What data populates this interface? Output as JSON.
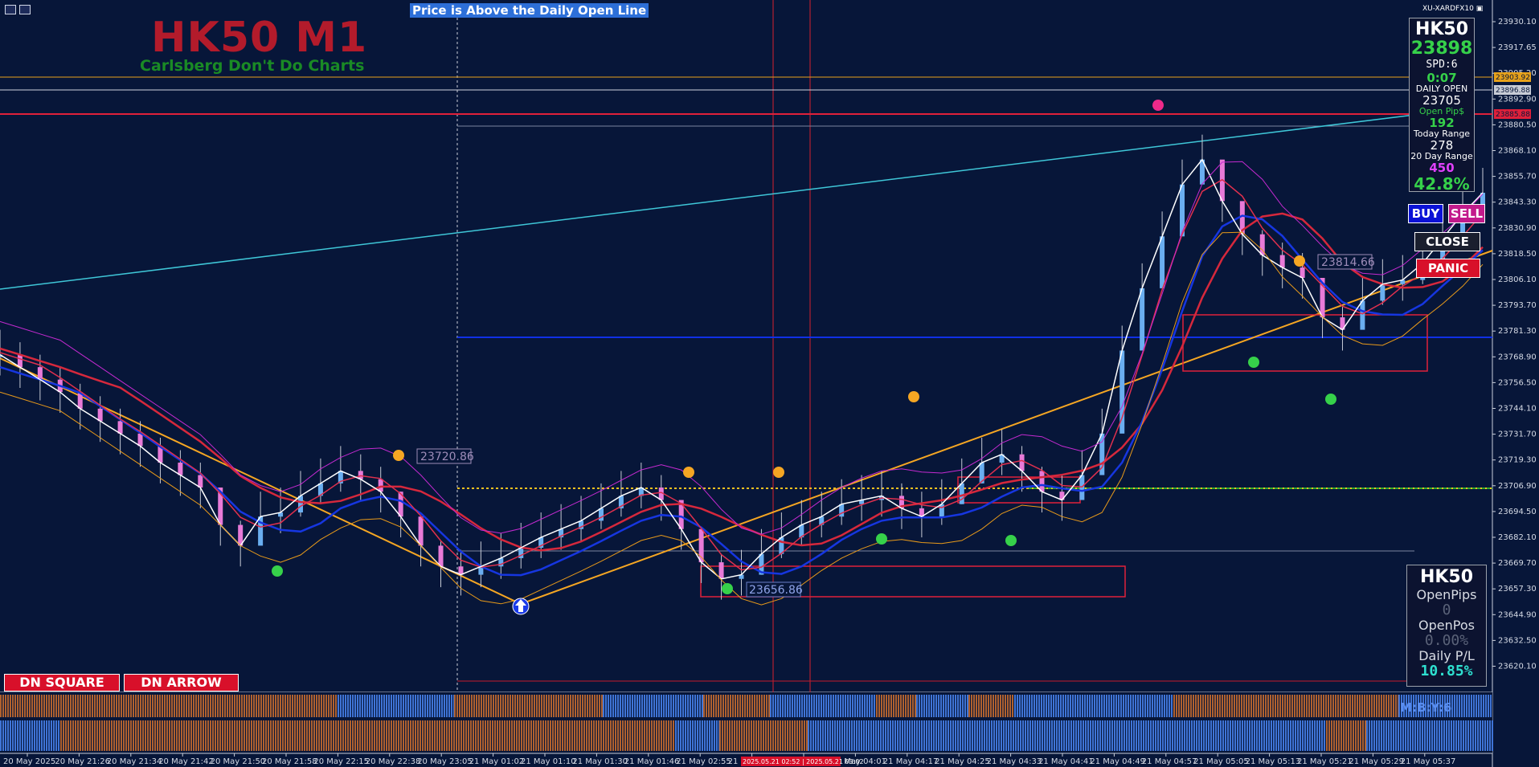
{
  "header": {
    "banner": "Price is Above the Daily Open Line",
    "title": "HK50 M1",
    "subtitle": "Carlsberg Don't Do Charts",
    "symbol_badge": "XU-XARDFX10"
  },
  "toolbar_icons": [
    "chart-list-icon",
    "chart-properties-icon"
  ],
  "info_panel": {
    "symbol": "HK50",
    "price": "23898",
    "spread": "SPD:6",
    "timer": "0:07",
    "daily_open_label": "DAILY OPEN",
    "daily_open": "23705",
    "open_pips_label": "Open Pip$",
    "open_pips": "192",
    "today_range_label": "Today Range",
    "today_range": "278",
    "day20_range_label": "20 Day Range",
    "day20_range": "450",
    "pct": "42.8%"
  },
  "trade_buttons": {
    "buy": "BUY",
    "sell": "SELL",
    "close": "CLOSE",
    "panic": "PANIC"
  },
  "pl_panel": {
    "symbol": "HK50",
    "open_pips_label": "OpenPips",
    "open_pips": "0",
    "open_pos_label": "OpenPos",
    "open_pos": "0.00%",
    "daily_pl_label": "Daily P/L",
    "daily_pl": "10.85%"
  },
  "bottom_buttons": {
    "dn_square": "DN SQUARE",
    "dn_arrow": "DN ARROW"
  },
  "indicator_label": "M:B:Y:6",
  "annotations": {
    "label_a": "23720.86",
    "label_b": "23656.86",
    "label_c": "23814.66"
  },
  "price_axis": {
    "ticks": [
      "23930.10",
      "23917.65",
      "23905.20",
      "23892.90",
      "23880.50",
      "23868.10",
      "23855.70",
      "23843.30",
      "23830.90",
      "23818.50",
      "23806.10",
      "23793.70",
      "23781.30",
      "23768.90",
      "23756.50",
      "23744.10",
      "23731.70",
      "23719.30",
      "23706.90",
      "23694.50",
      "23682.10",
      "23669.70",
      "23657.30",
      "23644.90",
      "23632.50",
      "23620.10"
    ],
    "tags": [
      {
        "text": "23903.92",
        "color": "#e8a21a"
      },
      {
        "text": "23896.88",
        "color": "#c8ccd6"
      },
      {
        "text": "23885.88",
        "color": "#e0203a"
      }
    ]
  },
  "time_axis": {
    "labels": [
      "20 May 2025",
      "20 May 21:26",
      "20 May 21:34",
      "20 May 21:42",
      "20 May 21:50",
      "20 May 21:58",
      "20 May 22:15",
      "20 May 22:38",
      "20 May 23:05",
      "21 May 01:02",
      "21 May 01:10",
      "21 May 01:30",
      "21 May 01:46",
      "21 May 02:55",
      "21 May",
      "21 May 03:32",
      "21 May 04:01",
      "21 May 04:17",
      "21 May 04:25",
      "21 May 04:33",
      "21 May 04:41",
      "21 May 04:49",
      "21 May 04:57",
      "21 May 05:05",
      "21 May 05:13",
      "21 May 05:21",
      "21 May 05:29",
      "21 May 05:37"
    ],
    "highlight": "2025.05.21 02:52 | 2025.05.21 03:02"
  },
  "colors": {
    "background": "#071639",
    "bull_histogram": "#3f74d6",
    "bear_histogram": "#b0612f",
    "daily_open_line": "#2ea82e",
    "resistance_line": "#e0203a",
    "support_line": "#1030e6",
    "trend_line": "#f5a623",
    "channel_line": "#3fc7d8"
  },
  "chart_data": {
    "type": "line",
    "symbol": "HK50",
    "timeframe": "M1",
    "ylim": [
      23610,
      23935
    ],
    "levels": {
      "daily_open": 23705,
      "orange_level": 23903.92,
      "grey_level": 23896.88,
      "red_level": 23885.88,
      "blue_level": 23781.3
    },
    "series": [
      {
        "values": [
          23768,
          23762,
          23756,
          23750,
          23742,
          23736,
          23730,
          23724,
          23716,
          23710,
          23704,
          23686,
          23676,
          23690,
          23692,
          23700,
          23706,
          23712,
          23708,
          23702,
          23690,
          23676,
          23666,
          23662,
          23666,
          23670,
          23675,
          23680,
          23684,
          23688,
          23694,
          23700,
          23704,
          23698,
          23684,
          23668,
          23660,
          23662,
          23672,
          23680,
          23686,
          23690,
          23696,
          23698,
          23700,
          23694,
          23690,
          23696,
          23706,
          23716,
          23720,
          23712,
          23702,
          23698,
          23710,
          23730,
          23770,
          23800,
          23825,
          23850,
          23862,
          23842,
          23826,
          23816,
          23810,
          23805,
          23786,
          23780,
          23794,
          23802,
          23804,
          23812,
          23824,
          23836,
          23846
        ]
      }
    ]
  }
}
